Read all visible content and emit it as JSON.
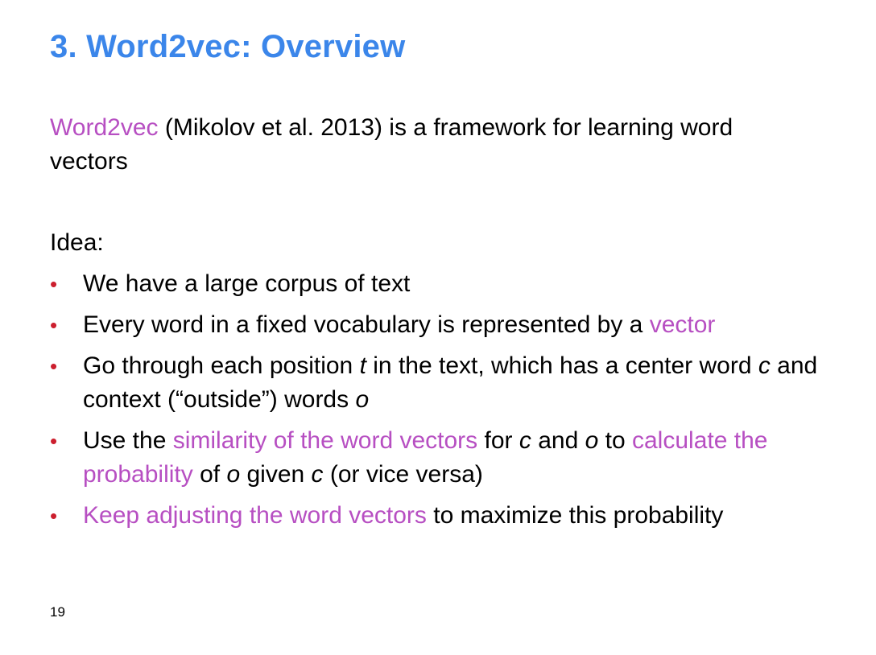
{
  "slide": {
    "title": "3. Word2vec: Overview",
    "page_number": "19",
    "colors": {
      "title": "#3b86ea",
      "highlight": "#b74fc2",
      "bullet": "#cc1f2e",
      "text": "#000000",
      "background": "#ffffff"
    },
    "intro": {
      "highlight": "Word2vec",
      "rest": " (Mikolov et al. 2013) is a framework for learning word vectors"
    },
    "idea_label": "Idea:",
    "bullet_marker": "•",
    "bullets": [
      {
        "text": "We have a large corpus of text"
      },
      {
        "text": "Every word in a fixed vocabulary is represented by a ",
        "highlight": "vector"
      },
      {
        "part1": "Go through each position ",
        "var_t": "t",
        "part2": " in the text, which has a center word ",
        "var_c": "c",
        "part3": " and context (“outside”) words ",
        "var_o": "o"
      },
      {
        "part1": "Use the ",
        "highlight1": "similarity of the word vectors",
        "part2": " for ",
        "var_c": "c",
        "part3": " and ",
        "var_o": "o",
        "part4": " to ",
        "highlight2": "calculate the probability",
        "part5": " of ",
        "var_o2": "o",
        "part6": " given ",
        "var_c2": "c",
        "part7": " (or vice versa)"
      },
      {
        "highlight": "Keep adjusting the word vectors",
        "text": " to maximize this probability"
      }
    ]
  }
}
